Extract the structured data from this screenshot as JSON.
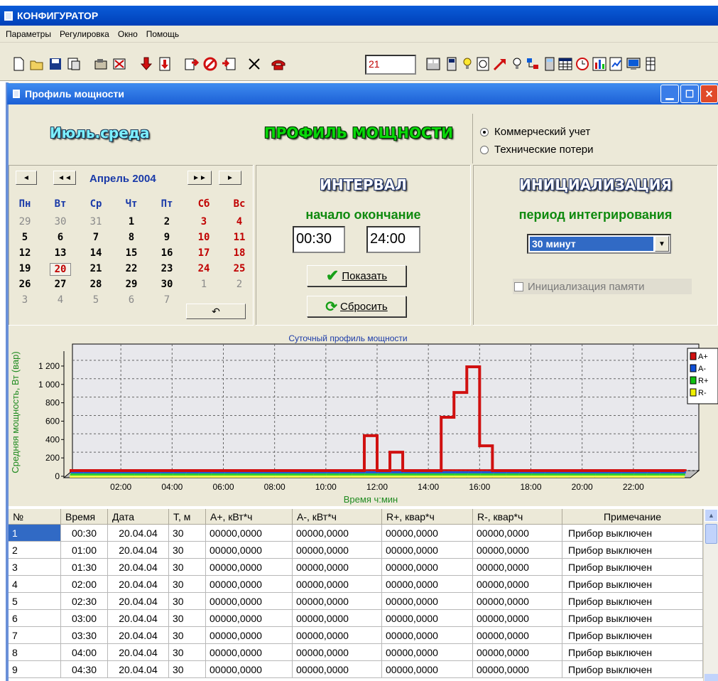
{
  "app": {
    "title": "КОНФИГУРАТОР"
  },
  "menu": [
    "Параметры",
    "Регулировка",
    "Окно",
    "Помощь"
  ],
  "toolbar": {
    "field_value": "21"
  },
  "window": {
    "title": "Профиль мощности"
  },
  "header": {
    "day_label": "Июль.среда",
    "profile_title": "ПРОФИЛЬ МОЩНОСТИ",
    "radio_options": [
      {
        "label": "Коммерческий учет",
        "checked": true
      },
      {
        "label": "Технические потери",
        "checked": false
      }
    ]
  },
  "calendar": {
    "month_label": "Апрель 2004",
    "weekdays": [
      "Пн",
      "Вт",
      "Ср",
      "Чт",
      "Пт",
      "Сб",
      "Вс"
    ],
    "weeks": [
      [
        "29",
        "30",
        "31",
        "1",
        "2",
        "3",
        "4"
      ],
      [
        "5",
        "6",
        "7",
        "8",
        "9",
        "10",
        "11"
      ],
      [
        "12",
        "13",
        "14",
        "15",
        "16",
        "17",
        "18"
      ],
      [
        "19",
        "20",
        "21",
        "22",
        "23",
        "24",
        "25"
      ],
      [
        "26",
        "27",
        "28",
        "29",
        "30",
        "1",
        "2"
      ],
      [
        "3",
        "4",
        "5",
        "6",
        "7"
      ]
    ],
    "selected_day": "20"
  },
  "interval": {
    "title": "ИНТЕРВАЛ",
    "subtitle": "начало окончание",
    "start": "00:30",
    "end": "24:00",
    "show_button": "Показать",
    "reset_button": "Сбросить"
  },
  "init": {
    "title": "ИНИЦИАЛИЗАЦИЯ",
    "subtitle": "период интегрирования",
    "period": "30 минут",
    "memory_checkbox": "Инициализация памяти"
  },
  "chart_data": {
    "type": "line",
    "title": "Суточный профиль мощности",
    "xlabel": "Время ч:мин",
    "ylabel": "Средняя мощность, Вт (вар)",
    "x_ticks": [
      "02:00",
      "04:00",
      "06:00",
      "08:00",
      "10:00",
      "12:00",
      "14:00",
      "16:00",
      "18:00",
      "20:00",
      "22:00"
    ],
    "y_ticks": [
      "0",
      "200",
      "400",
      "600",
      "800",
      "1 000",
      "1 200"
    ],
    "ylim": [
      0,
      1300
    ],
    "legend": [
      "A+",
      "A-",
      "R+",
      "R-"
    ],
    "colors": {
      "A+": "#d01010",
      "A-": "#1050d8",
      "R+": "#10c010",
      "R-": "#f0f000"
    },
    "series": [
      {
        "name": "A+",
        "points": [
          [
            0,
            0
          ],
          [
            11.5,
            0
          ],
          [
            11.5,
            380
          ],
          [
            12,
            380
          ],
          [
            12,
            0
          ],
          [
            12.5,
            0
          ],
          [
            12.5,
            200
          ],
          [
            13,
            200
          ],
          [
            13,
            0
          ],
          [
            14.5,
            0
          ],
          [
            14.5,
            580
          ],
          [
            15,
            580
          ],
          [
            15,
            850
          ],
          [
            15.5,
            850
          ],
          [
            15.5,
            1130
          ],
          [
            16,
            1130
          ],
          [
            16,
            270
          ],
          [
            16.5,
            270
          ],
          [
            16.5,
            0
          ],
          [
            24,
            0
          ]
        ]
      }
    ]
  },
  "table": {
    "columns": [
      "№",
      "Время",
      "Дата",
      "Т, м",
      "А+, кВт*ч",
      "А-, кВт*ч",
      "R+, квар*ч",
      "R-, квар*ч",
      "Примечание"
    ],
    "rows": [
      [
        "1",
        "00:30",
        "20.04.04",
        "30",
        "00000,0000",
        "00000,0000",
        "00000,0000",
        "00000,0000",
        "Прибор выключен"
      ],
      [
        "2",
        "01:00",
        "20.04.04",
        "30",
        "00000,0000",
        "00000,0000",
        "00000,0000",
        "00000,0000",
        "Прибор выключен"
      ],
      [
        "3",
        "01:30",
        "20.04.04",
        "30",
        "00000,0000",
        "00000,0000",
        "00000,0000",
        "00000,0000",
        "Прибор выключен"
      ],
      [
        "4",
        "02:00",
        "20.04.04",
        "30",
        "00000,0000",
        "00000,0000",
        "00000,0000",
        "00000,0000",
        "Прибор выключен"
      ],
      [
        "5",
        "02:30",
        "20.04.04",
        "30",
        "00000,0000",
        "00000,0000",
        "00000,0000",
        "00000,0000",
        "Прибор выключен"
      ],
      [
        "6",
        "03:00",
        "20.04.04",
        "30",
        "00000,0000",
        "00000,0000",
        "00000,0000",
        "00000,0000",
        "Прибор выключен"
      ],
      [
        "7",
        "03:30",
        "20.04.04",
        "30",
        "00000,0000",
        "00000,0000",
        "00000,0000",
        "00000,0000",
        "Прибор выключен"
      ],
      [
        "8",
        "04:00",
        "20.04.04",
        "30",
        "00000,0000",
        "00000,0000",
        "00000,0000",
        "00000,0000",
        "Прибор выключен"
      ],
      [
        "9",
        "04:30",
        "20.04.04",
        "30",
        "00000,0000",
        "00000,0000",
        "00000,0000",
        "00000,0000",
        "Прибор выключен"
      ]
    ]
  }
}
